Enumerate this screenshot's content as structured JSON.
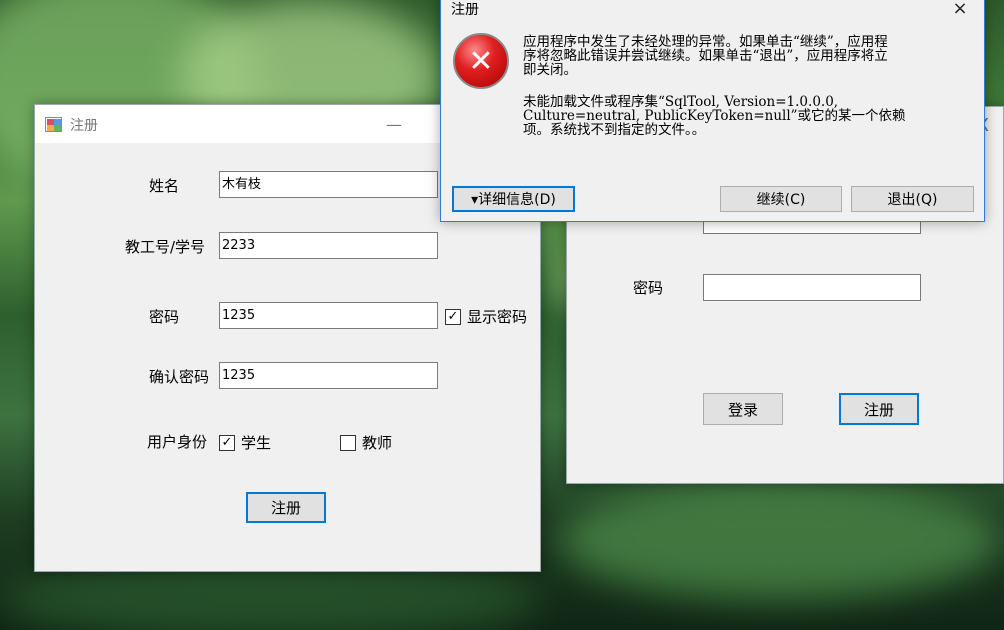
{
  "register_window": {
    "title": "注册",
    "minimize_glyph": "—",
    "fields": {
      "name_label": "姓名",
      "name_value": "木有枝",
      "id_label": "教工号/学号",
      "id_value": "2233",
      "password_label": "密码",
      "password_value": "1235",
      "show_password_label": "显示密码",
      "confirm_label": "确认密码",
      "confirm_value": "1235"
    },
    "role_label": "用户身份",
    "role_student": "学生",
    "role_teacher": "教师",
    "register_button": "注册"
  },
  "login_window": {
    "close_glyph": "X",
    "password_label": "密码",
    "login_button": "登录",
    "register_button": "注册"
  },
  "error_dialog": {
    "title": "注册",
    "close_glyph": "×",
    "icon_glyph": "✕",
    "message_line1": "应用程序中发生了未经处理的异常。如果单击“继续”，应用程",
    "message_line2": "序将忽略此错误并尝试继续。如果单击“退出”，应用程序将立",
    "message_line3": "即关闭。",
    "detail_line1": "未能加载文件或程序集“SqlTool, Version=1.0.0.0,",
    "detail_line2": "Culture=neutral, PublicKeyToken=null”或它的某一个依赖",
    "detail_line3": "项。系统找不到指定的文件。。",
    "details_button": "▾详细信息(D)",
    "continue_button": "继续(C)",
    "quit_button": "退出(Q)"
  },
  "colors": {
    "accent": "#0078d7",
    "window_bg": "#f0f0f0",
    "error_red": "#e02020"
  }
}
